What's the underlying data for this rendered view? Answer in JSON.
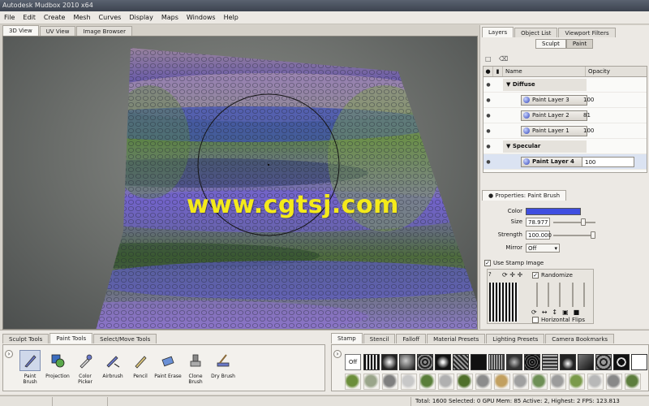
{
  "window": {
    "title": "Autodesk Mudbox 2010 x64"
  },
  "menu": [
    "File",
    "Edit",
    "Create",
    "Mesh",
    "Curves",
    "Display",
    "Maps",
    "Windows",
    "Help"
  ],
  "view_tabs": [
    "3D View",
    "UV View",
    "Image Browser"
  ],
  "watermark": "www.cgtsj.com",
  "right_tabs": [
    "Layers",
    "Object List",
    "Viewport Filters"
  ],
  "layer_mode": [
    "Sculpt",
    "Paint"
  ],
  "layer_table": {
    "headers": {
      "name": "Name",
      "opacity": "Opacity"
    },
    "groups": [
      {
        "name": "Diffuse",
        "layers": [
          {
            "name": "Paint Layer 3",
            "opacity": "100"
          },
          {
            "name": "Paint Layer 2",
            "opacity": "81"
          },
          {
            "name": "Paint Layer 1",
            "opacity": "100"
          }
        ]
      },
      {
        "name": "Specular",
        "layers": [
          {
            "name": "Paint Layer 4",
            "opacity": "100"
          }
        ]
      }
    ]
  },
  "properties": {
    "tab": "Properties: Paint Brush",
    "color_label": "Color",
    "color_value": "#3f4ee0",
    "size_label": "Size",
    "size_value": "78.977",
    "strength_label": "Strength",
    "strength_value": "100.000",
    "mirror_label": "Mirror",
    "mirror_value": "Off",
    "use_stamp_label": "Use Stamp Image",
    "randomize_label": "Randomize",
    "horizontal_flips_label": "Horizontal Flips"
  },
  "tool_tabs": [
    "Sculpt Tools",
    "Paint Tools",
    "Select/Move Tools"
  ],
  "tools": [
    "Paint Brush",
    "Projection",
    "Color Picker",
    "Airbrush",
    "Pencil",
    "Paint Erase",
    "Clone Brush",
    "Dry Brush"
  ],
  "stamp_tabs": [
    "Stamp",
    "Stencil",
    "Falloff",
    "Material Presets",
    "Lighting Presets",
    "Camera Bookmarks"
  ],
  "stamp_off": "Off",
  "status": "Total: 1600  Selected: 0 GPU Mem: 85  Active: 2, Highest: 2  FPS: 123.813"
}
